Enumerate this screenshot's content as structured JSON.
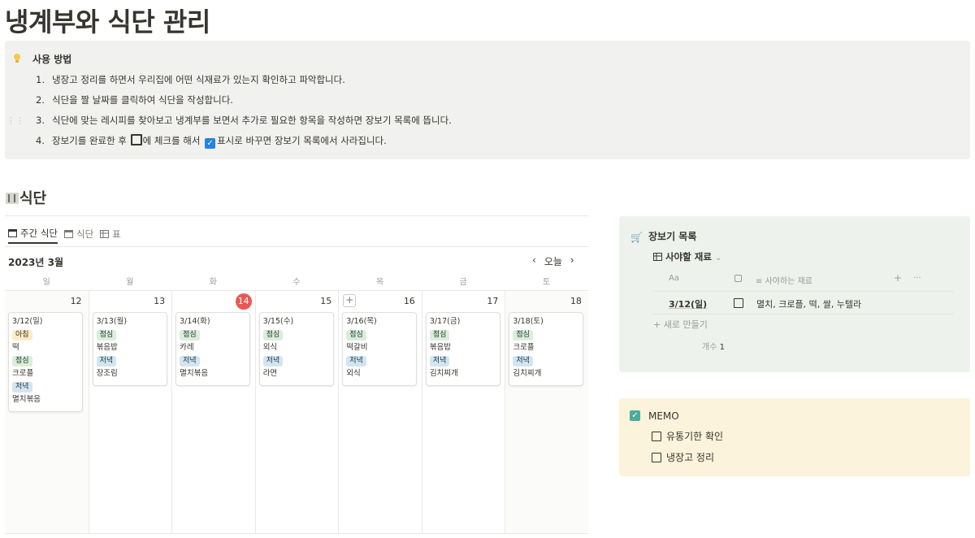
{
  "page": {
    "title": "냉계부와 식단 관리"
  },
  "callout": {
    "title": "사용 방법",
    "steps": [
      {
        "num": "1.",
        "text": "냉장고 정리를 하면서 우리집에 어떤 식재료가 있는지 확인하고 파악합니다."
      },
      {
        "num": "2.",
        "text": "식단을 짤 날짜를 클릭하여 식단을 작성합니다."
      },
      {
        "num": "3.",
        "text": "식단에 맞는 레시피를 찾아보고 냉계부를 보면서 추가로 필요한 항목을 작성하면 장보기 목록에 뜹니다."
      },
      {
        "num": "4.",
        "pre": "장보기를 완료한 후 ",
        "mid": "에 체크를 해서 ",
        "post": "표시로 바꾸면 장보기 목록에서 사라집니다."
      }
    ]
  },
  "meal_section": {
    "title": "식단",
    "tabs": [
      "주간 식단",
      "식단",
      "표"
    ],
    "month": "2023년 3월",
    "nav": {
      "prev": "‹",
      "today": "오늘",
      "next": "›"
    },
    "weekdays": [
      "일",
      "월",
      "화",
      "수",
      "목",
      "금",
      "토"
    ],
    "days": [
      {
        "num": "12",
        "date": "3/12(일)",
        "today": false,
        "items": [
          {
            "tag": "아침",
            "kind": "morning",
            "food": "떡"
          },
          {
            "tag": "점심",
            "kind": "lunch",
            "food": "크로플"
          },
          {
            "tag": "저녁",
            "kind": "dinner",
            "food": "멸치볶음"
          }
        ]
      },
      {
        "num": "13",
        "date": "3/13(월)",
        "today": false,
        "items": [
          {
            "tag": "점심",
            "kind": "lunch",
            "food": "볶음밥"
          },
          {
            "tag": "저녁",
            "kind": "dinner",
            "food": "장조림"
          }
        ]
      },
      {
        "num": "14",
        "date": "3/14(화)",
        "today": true,
        "items": [
          {
            "tag": "점심",
            "kind": "lunch",
            "food": "카레"
          },
          {
            "tag": "저녁",
            "kind": "dinner",
            "food": "멸치볶음"
          }
        ]
      },
      {
        "num": "15",
        "date": "3/15(수)",
        "today": false,
        "items": [
          {
            "tag": "점심",
            "kind": "lunch",
            "food": "외식"
          },
          {
            "tag": "저녁",
            "kind": "dinner",
            "food": "라면"
          }
        ]
      },
      {
        "num": "16",
        "date": "3/16(목)",
        "today": false,
        "items": [
          {
            "tag": "점심",
            "kind": "lunch",
            "food": "떡갈비"
          },
          {
            "tag": "저녁",
            "kind": "dinner",
            "food": "외식"
          }
        ]
      },
      {
        "num": "17",
        "date": "3/17(금)",
        "today": false,
        "items": [
          {
            "tag": "점심",
            "kind": "lunch",
            "food": "볶음밥"
          },
          {
            "tag": "저녁",
            "kind": "dinner",
            "food": "김치찌개"
          }
        ]
      },
      {
        "num": "18",
        "date": "3/18(토)",
        "today": false,
        "items": [
          {
            "tag": "점심",
            "kind": "lunch",
            "food": "크로플"
          },
          {
            "tag": "저녁",
            "kind": "dinner",
            "food": "김치찌개"
          }
        ]
      }
    ]
  },
  "shopping": {
    "title": "장보기 목록",
    "view": "사야할 재료",
    "columns": {
      "name": "Aa",
      "ingredients": "사야하는 재료",
      "add": "+",
      "more": "···"
    },
    "rows": [
      {
        "date": "3/12(일)",
        "items": "멸치, 크로플, 떡, 쌀, 누텔라"
      }
    ],
    "new_row": "+ 새로 만들기",
    "count_label": "개수",
    "count": "1"
  },
  "memo": {
    "title": "MEMO",
    "items": [
      "유통기한 확인",
      "냉장고 정리"
    ]
  },
  "colors": {
    "today": "#eb5757",
    "shop_bg": "#edf3ec",
    "memo_bg": "#fbf3db",
    "callout_bg": "#f1f1ef"
  },
  "icons": [
    "lightbulb-icon",
    "fork-knife-icon",
    "calendar-icon",
    "table-icon",
    "cart-icon",
    "checkbox-icon"
  ]
}
